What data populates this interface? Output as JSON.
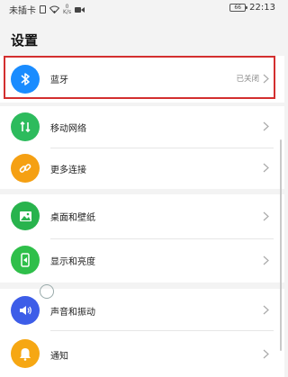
{
  "status_bar": {
    "carrier": "未插卡",
    "speed_top": "0",
    "speed_unit": "K/s",
    "battery": "66",
    "time": "22:13"
  },
  "page": {
    "title": "设置"
  },
  "groups": [
    {
      "items": [
        {
          "label": "蓝牙",
          "value": "已关闭",
          "icon": "bluetooth-icon",
          "color": "#1a8cff"
        }
      ]
    },
    {
      "items": [
        {
          "label": "移动网络",
          "icon": "mobile-network-icon",
          "color": "#2dbb5d"
        },
        {
          "label": "更多连接",
          "icon": "link-icon",
          "color": "#f5a013"
        }
      ]
    },
    {
      "items": [
        {
          "label": "桌面和壁纸",
          "icon": "wallpaper-icon",
          "color": "#28b34d"
        },
        {
          "label": "显示和亮度",
          "icon": "display-icon",
          "color": "#2fbf4a"
        }
      ]
    },
    {
      "items": [
        {
          "label": "声音和振动",
          "icon": "sound-icon",
          "color": "#3d5de8"
        },
        {
          "label": "通知",
          "icon": "bell-icon",
          "color": "#f6a713"
        }
      ]
    }
  ]
}
